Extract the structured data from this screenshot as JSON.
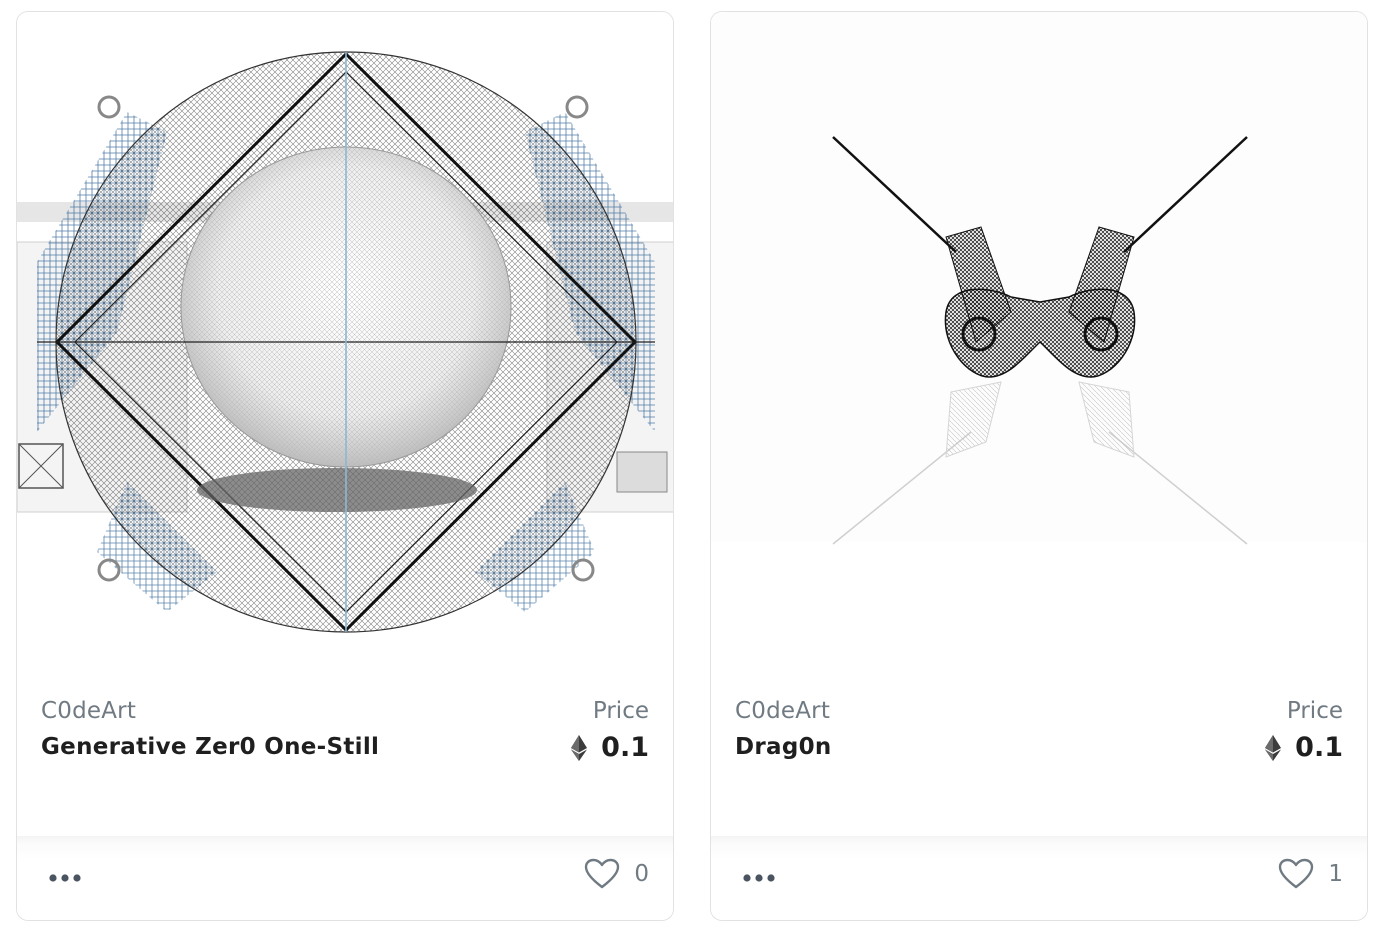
{
  "cards": [
    {
      "creator": "C0deArt",
      "title": "Generative Zer0 One-Still",
      "price_label": "Price",
      "price": "0.1",
      "currency_icon": "ethereum-icon",
      "likes": "0",
      "artwork": "generative-sphere-diamond-wireframe"
    },
    {
      "creator": "C0deArt",
      "title": "Drag0n",
      "price_label": "Price",
      "price": "0.1",
      "currency_icon": "ethereum-icon",
      "likes": "1",
      "artwork": "dragon-wireframe"
    }
  ],
  "colors": {
    "text_primary": "#1f1f1f",
    "text_secondary": "#707a83",
    "border": "#e2e2e2",
    "accent_blue": "#3d6f9e"
  }
}
